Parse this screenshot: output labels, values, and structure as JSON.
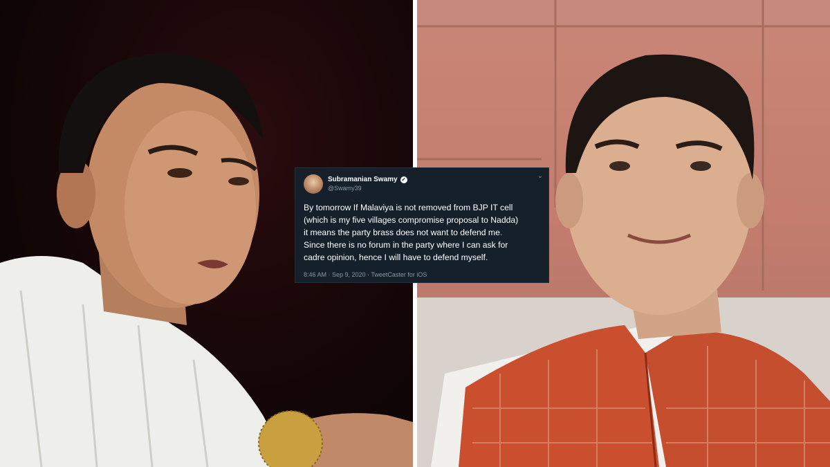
{
  "tweet": {
    "name": "Subramanian Swamy",
    "verified_icon": "verified-badge-icon",
    "handle": "@Swamy39",
    "menu_icon": "chevron-down-icon",
    "lines": [
      "By tomorrow If Malaviya is not removed from BJP IT cell",
      "(which is my five villages compromise proposal to Nadda)",
      "it means the party brass does not want to defend me.",
      "Since there is no forum in the party where I can ask for",
      "cadre opinion, hence I will have to defend myself."
    ],
    "meta": "8:46 AM · Sep 9, 2020 · TweetCaster for iOS"
  },
  "colors": {
    "tweet_bg": "#15202b",
    "tweet_meta": "#8899a6",
    "left_bg": "#140607",
    "right_wall": "#c47d6f",
    "jacket": "#c94f2f"
  }
}
